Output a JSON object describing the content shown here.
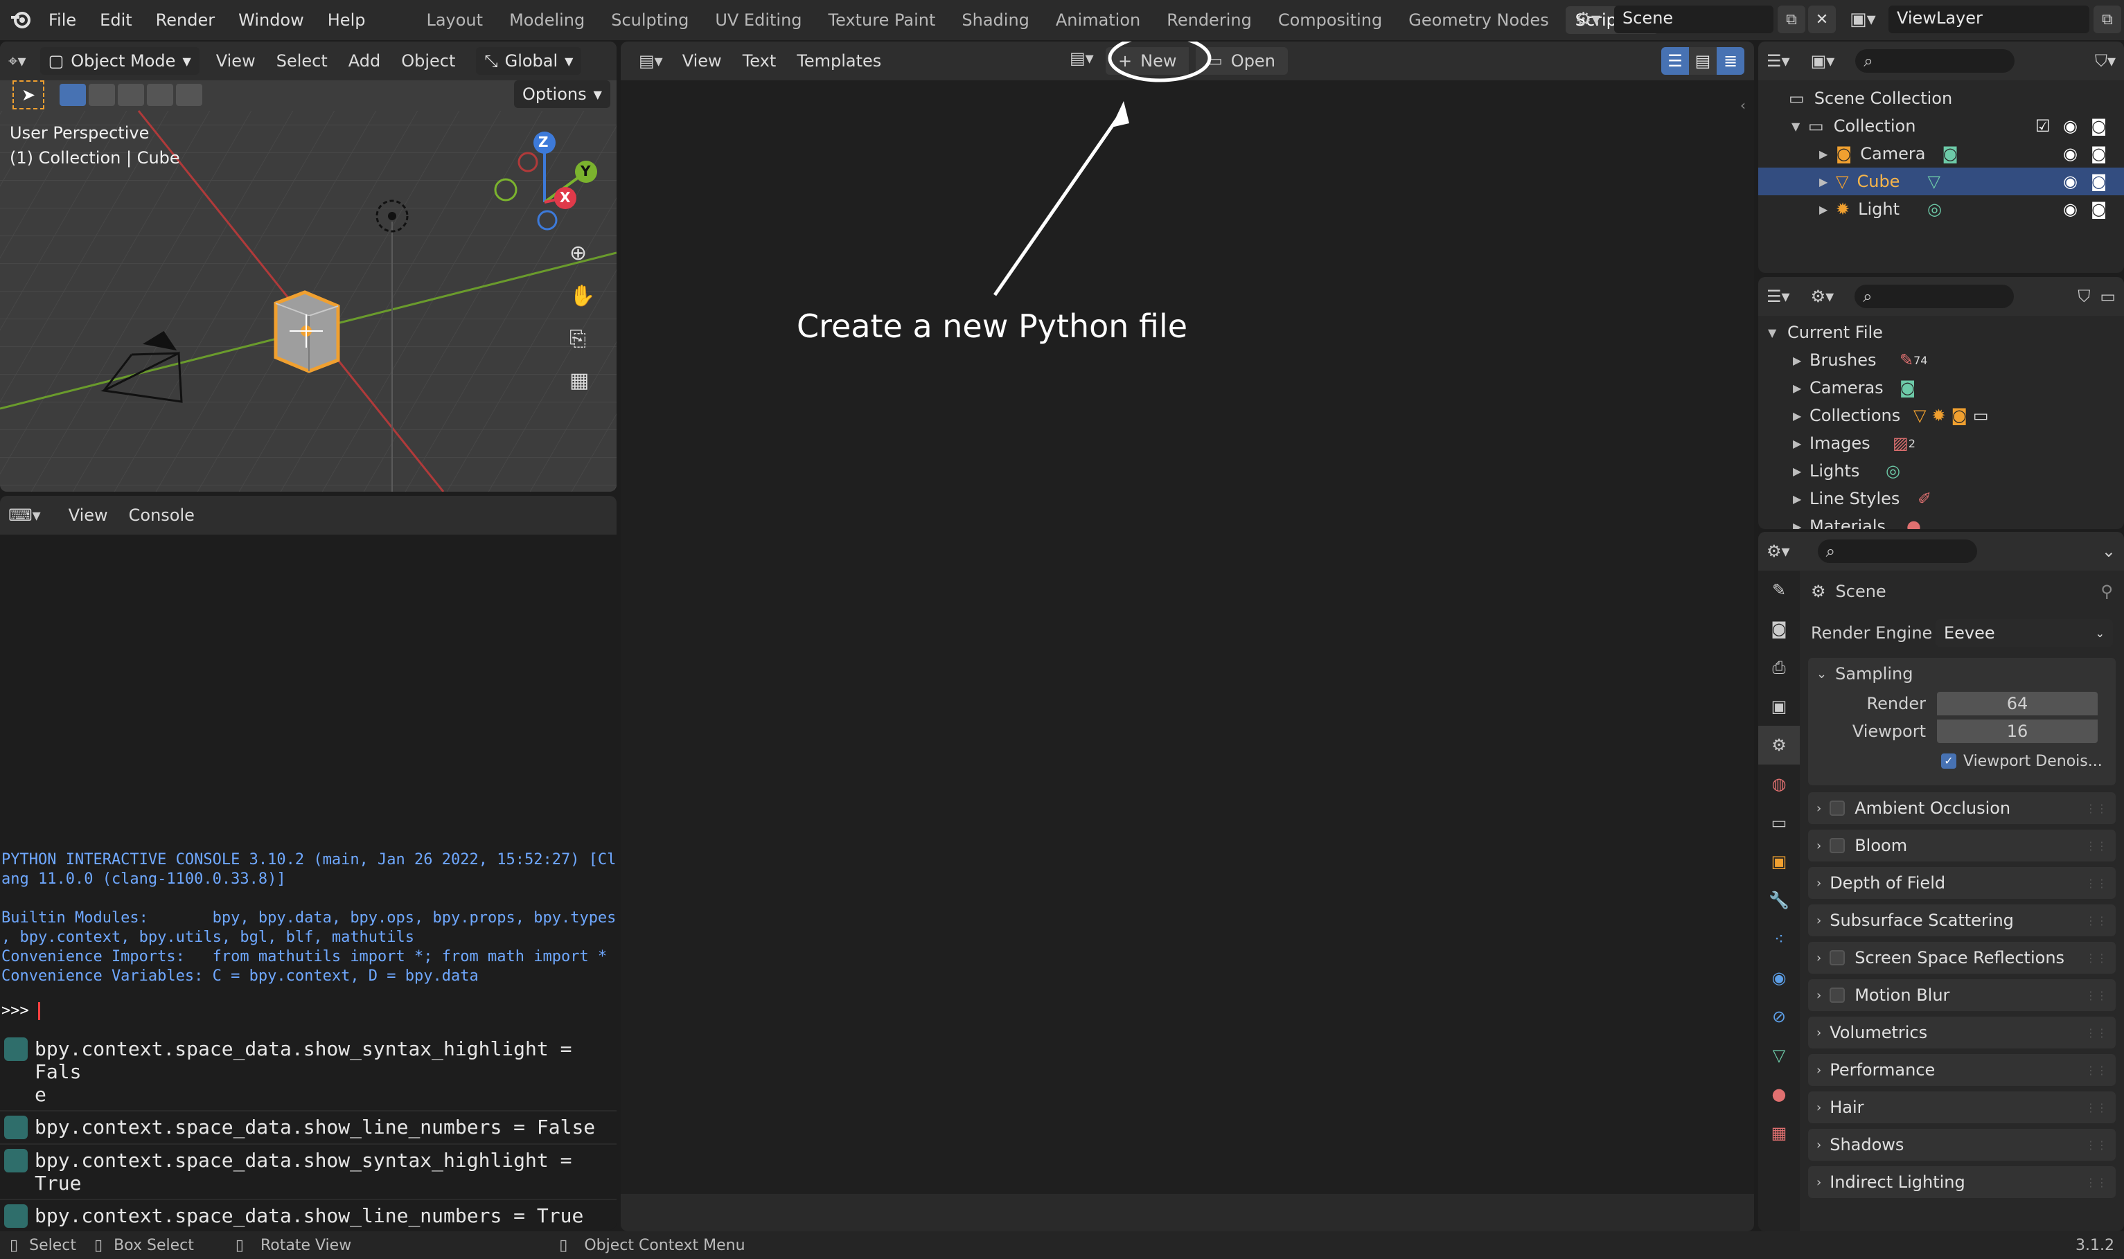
{
  "topbar": {
    "menu": [
      "File",
      "Edit",
      "Render",
      "Window",
      "Help"
    ],
    "workspaces": [
      "Layout",
      "Modeling",
      "Sculpting",
      "UV Editing",
      "Texture Paint",
      "Shading",
      "Animation",
      "Rendering",
      "Compositing",
      "Geometry Nodes",
      "Scripting"
    ],
    "active_workspace": "Scripting",
    "add_workspace": "+",
    "scene": "Scene",
    "view_layer": "ViewLayer"
  },
  "viewport": {
    "mode": "Object Mode",
    "menus": [
      "View",
      "Select",
      "Add",
      "Object"
    ],
    "transform": "Global",
    "options": "Options",
    "overlay_line1": "User Perspective",
    "overlay_line2": "(1) Collection | Cube",
    "gizmo": {
      "x": "X",
      "y": "Y",
      "z": "Z"
    }
  },
  "console": {
    "menus": [
      "View",
      "Console"
    ],
    "banner_1": "PYTHON INTERACTIVE CONSOLE 3.10.2 (main, Jan 26 2022, 15:52:27) [Cl",
    "banner_2": "ang 11.0.0 (clang-1100.0.33.8)]",
    "modules_1": "Builtin Modules:       bpy, bpy.data, bpy.ops, bpy.props, bpy.types",
    "modules_2": ", bpy.context, bpy.utils, bgl, blf, mathutils",
    "imports": "Convenience Imports:   from mathutils import *; from math import *",
    "variables": "Convenience Variables: C = bpy.context, D = bpy.data",
    "prompt": ">>> ",
    "history": [
      "bpy.context.space_data.show_syntax_highlight = Fals\ne",
      "bpy.context.space_data.show_line_numbers = False",
      "bpy.context.space_data.show_syntax_highlight = True",
      "bpy.context.space_data.show_line_numbers = True"
    ]
  },
  "text_editor": {
    "menus": [
      "View",
      "Text",
      "Templates"
    ],
    "new_label": "New",
    "open_label": "Open",
    "annotation": "Create a new Python file"
  },
  "outliner": {
    "root": "Scene Collection",
    "collection": "Collection",
    "items": [
      "Camera",
      "Cube",
      "Light"
    ],
    "selected": "Cube"
  },
  "blend_file": {
    "root": "Current File",
    "items": [
      "Brushes",
      "Cameras",
      "Collections",
      "Images",
      "Lights",
      "Line Styles",
      "Materials"
    ],
    "brush_count": "74",
    "image_count": "2"
  },
  "properties": {
    "context": "Scene",
    "render_engine_label": "Render Engine",
    "render_engine": "Eevee",
    "sampling": "Sampling",
    "render_label": "Render",
    "render_value": "64",
    "viewport_label": "Viewport",
    "viewport_value": "16",
    "viewport_denoise": "Viewport Denois...",
    "sections": [
      {
        "label": "Ambient Occlusion",
        "checkbox": true
      },
      {
        "label": "Bloom",
        "checkbox": true
      },
      {
        "label": "Depth of Field",
        "checkbox": false
      },
      {
        "label": "Subsurface Scattering",
        "checkbox": false
      },
      {
        "label": "Screen Space Reflections",
        "checkbox": true
      },
      {
        "label": "Motion Blur",
        "checkbox": true
      },
      {
        "label": "Volumetrics",
        "checkbox": false
      },
      {
        "label": "Performance",
        "checkbox": false
      },
      {
        "label": "Hair",
        "checkbox": false
      },
      {
        "label": "Shadows",
        "checkbox": false
      },
      {
        "label": "Indirect Lighting",
        "checkbox": false
      }
    ]
  },
  "statusbar": {
    "select": "Select",
    "box_select": "Box Select",
    "rotate_view": "Rotate View",
    "context_menu": "Object Context Menu",
    "version": "3.1.2"
  },
  "colors": {
    "accent": "#4772b3",
    "selection": "#334d80",
    "cube_orange": "#f0a030",
    "console_blue": "#6fa8ff"
  }
}
